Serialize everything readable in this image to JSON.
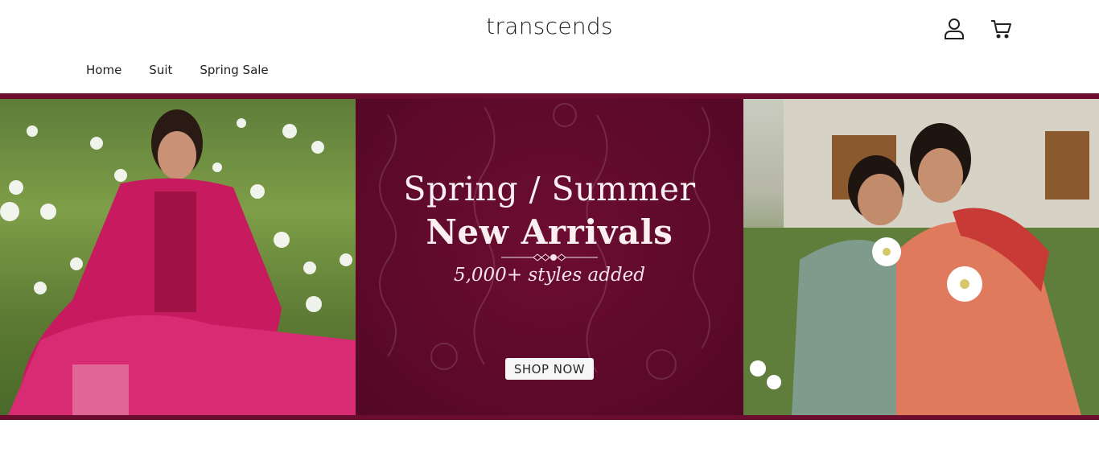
{
  "header": {
    "logo": "transcends",
    "icons": [
      "account-icon",
      "cart-icon"
    ]
  },
  "nav": {
    "items": [
      {
        "label": "Home"
      },
      {
        "label": "Suit"
      },
      {
        "label": "Spring Sale"
      }
    ]
  },
  "banner": {
    "headline_line1": "Spring / Summer",
    "headline_line2": "New Arrivals",
    "subheadline": "5,000+ styles added",
    "cta_label": "SHOP NOW",
    "colors": {
      "background": "#5a0a26",
      "text": "#fbeff2",
      "cta_background": "#f6f6f6"
    }
  }
}
